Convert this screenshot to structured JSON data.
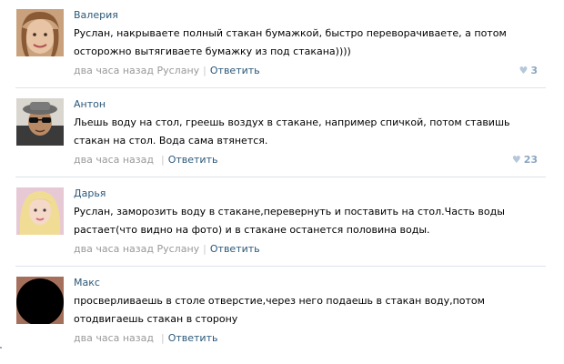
{
  "comments": [
    {
      "author": "Валерия",
      "text": "Руслан, накрываете полный стакан бумажкой, быстро переворачиваете, а потом осторожно вытягиваете бумажку из под стакана))))",
      "time": "два часа назад",
      "reply_to": "Руслану",
      "reply_label": "Ответить",
      "likes": "3"
    },
    {
      "author": "Антон",
      "text": "Льешь воду на стол, греешь воздух в стакане, например спичкой, потом ставишь стакан на стол. Вода сама втянется.",
      "time": "два часа назад",
      "reply_to": "",
      "reply_label": "Ответить",
      "likes": "23"
    },
    {
      "author": "Дарья",
      "text": "Руслан, заморозить воду в стакане,перевернуть и поставить на стол.Часть воды растает(что видно на фото) и в стакане останется половина воды.",
      "time": "два часа назад",
      "reply_to": "Руслану",
      "reply_label": "Ответить",
      "likes": ""
    },
    {
      "author": "Макс",
      "text": "просверливаешь в столе отверстие,через него подаешь в стакан воду,потом отодвигаешь стакан в сторону",
      "time": "два часа назад",
      "reply_to": "",
      "reply_label": "Ответить",
      "likes": ""
    }
  ],
  "icons": {
    "like": "heart-icon"
  },
  "colors": {
    "link": "#2b587a",
    "meta": "#999999",
    "likes": "#8aa6c1",
    "divider": "#dde3ea"
  }
}
